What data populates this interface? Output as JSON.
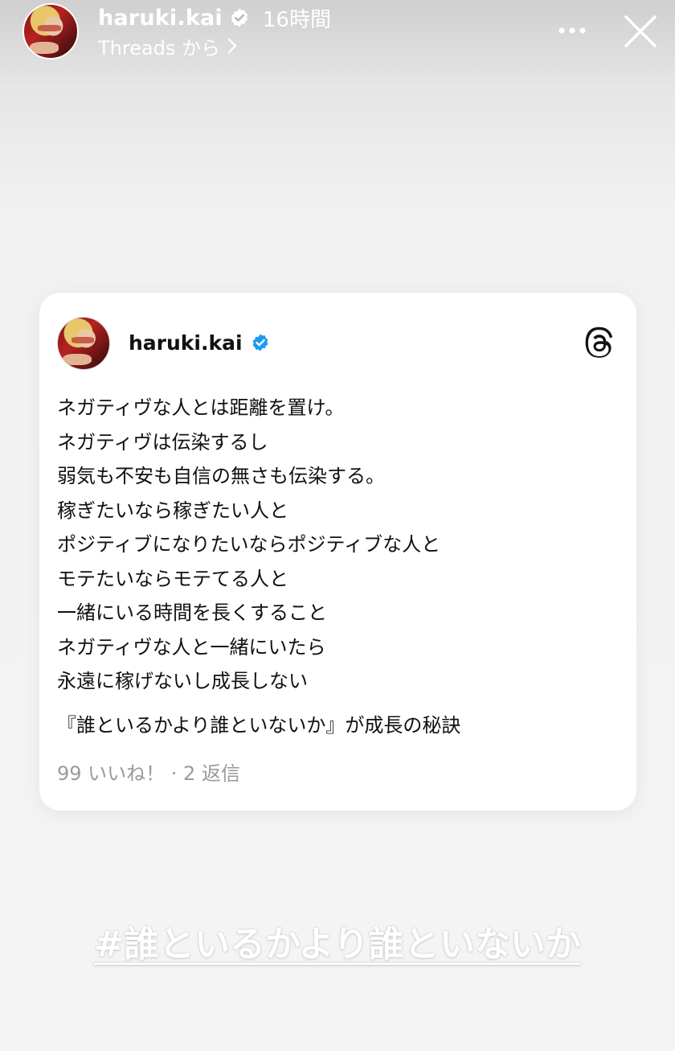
{
  "header": {
    "username": "haruki.kai",
    "time": "16時間",
    "source": "Threads から",
    "icons": {
      "verified": "verified-badge-icon",
      "more": "more-options-icon",
      "close": "close-icon",
      "chevron": "chevron-right-icon"
    }
  },
  "post": {
    "username": "haruki.kai",
    "lines": [
      "ネガティヴな人とは距離を置け。",
      "ネガティヴは伝染するし",
      "弱気も不安も自信の無さも伝染する。",
      "稼ぎたいなら稼ぎたい人と",
      "ポジティブになりたいならポジティブな人と",
      "モテたいならモテてる人と",
      "一緒にいる時間を長くすること",
      "ネガティヴな人と一緒にいたら",
      "永遠に稼げないし成長しない"
    ],
    "quote": "『誰といるかより誰といないか』が成長の秘訣",
    "stats": "99 いいね！ · 2 返信",
    "icons": {
      "logo": "threads-logo-icon",
      "verified": "verified-badge-icon"
    }
  },
  "hashtag": "#誰といるかより誰といないか",
  "colors": {
    "verified_blue": "#1d9bf0",
    "text": "#111111",
    "muted": "#9a9a9a",
    "card": "#ffffff"
  }
}
